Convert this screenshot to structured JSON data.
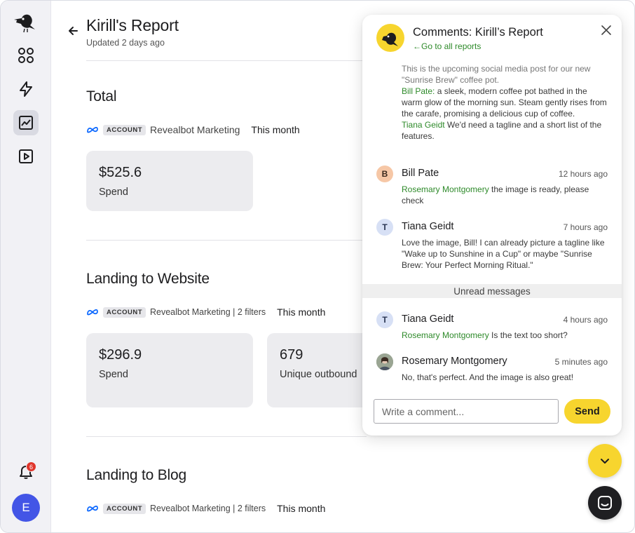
{
  "sidebar": {
    "notification_count": "6",
    "user_initial": "E"
  },
  "report": {
    "title": "Kirill's Report",
    "updated": "Updated 2 days ago"
  },
  "sections": [
    {
      "title": "Total",
      "account_tag": "ACCOUNT",
      "account_name": "Revealbot Marketing",
      "period": "This month",
      "cards": [
        {
          "value": "$525.6",
          "label": "Spend"
        }
      ]
    },
    {
      "title": "Landing to Website",
      "account_tag": "ACCOUNT",
      "account_name": "Revealbot Marketing | 2 filters",
      "period": "This month",
      "cards": [
        {
          "value": "$296.9",
          "label": "Spend"
        },
        {
          "value": "679",
          "label": "Unique outbound"
        }
      ]
    },
    {
      "title": "Landing to Blog",
      "account_tag": "ACCOUNT",
      "account_name": "Revealbot Marketing | 2 filters",
      "period": "This month"
    }
  ],
  "comments": {
    "title": "Comments: Kirill’s Report",
    "back_link": "←Go to all reports",
    "first_message": {
      "line1": "This is the upcoming social media post for our new \"Sunrise Brew\" coffee pot.",
      "mention1": "Bill Pate:",
      "text1": " a sleek, modern coffee pot bathed in the warm glow of the morning sun. Steam gently rises from the carafe, promising a delicious cup of coffee.",
      "mention2": "Tiana Geidt",
      "text2": " We'd need a tagline and a short list of the features."
    },
    "items": [
      {
        "initial": "B",
        "name": "Bill Pate",
        "time": "12 hours ago",
        "mention": "Rosemary Montgomery",
        "text": " the image is ready, please check"
      },
      {
        "initial": "T",
        "name": "Tiana Geidt",
        "time": "7 hours ago",
        "mention": "",
        "text": "Love the image, Bill! I can already picture a tagline like \"Wake up to Sunshine in a Cup\" or maybe \"Sunrise Brew: Your Perfect Morning Ritual.\""
      },
      {
        "initial": "T",
        "name": "Tiana Geidt",
        "time": "4 hours ago",
        "mention": "Rosemary Montgomery",
        "text": " Is the text too short?"
      },
      {
        "initial": "",
        "name": "Rosemary Montgomery",
        "time": "5 minutes ago",
        "mention": "",
        "text": "No, that's perfect. And the image is also great!"
      }
    ],
    "unread_label": "Unread messages",
    "input_placeholder": "Write a comment...",
    "send_label": "Send"
  },
  "colors": {
    "accent_yellow": "#f7d52e",
    "mention_green": "#2e8a2a",
    "avatar_blue": "#4355e6",
    "badge_red": "#e0352b"
  }
}
